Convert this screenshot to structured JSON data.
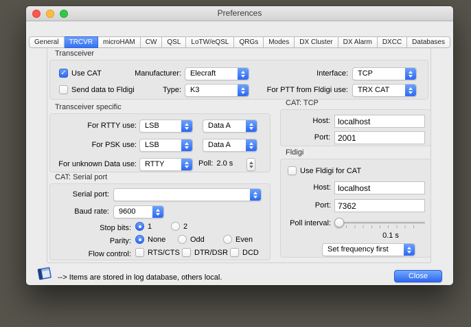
{
  "window": {
    "title": "Preferences",
    "tabs": [
      {
        "label": "General",
        "selected": false
      },
      {
        "label": "TRCVR",
        "selected": true
      },
      {
        "label": "microHAM",
        "selected": false
      },
      {
        "label": "CW",
        "selected": false
      },
      {
        "label": "QSL",
        "selected": false
      },
      {
        "label": "LoTW/eQSL",
        "selected": false
      },
      {
        "label": "QRGs",
        "selected": false
      },
      {
        "label": "Modes",
        "selected": false
      },
      {
        "label": "DX Cluster",
        "selected": false
      },
      {
        "label": "DX Alarm",
        "selected": false
      },
      {
        "label": "DXCC",
        "selected": false
      },
      {
        "label": "Databases",
        "selected": false
      }
    ]
  },
  "transceiver": {
    "group_label": "Transceiver",
    "use_cat": {
      "label": "Use CAT",
      "checked": true
    },
    "send_fldigi": {
      "label": "Send data to Fldigi",
      "checked": false
    },
    "manufacturer": {
      "label": "Manufacturer:",
      "value": "Elecraft"
    },
    "type": {
      "label": "Type:",
      "value": "K3"
    },
    "interface": {
      "label": "Interface:",
      "value": "TCP"
    },
    "ptt": {
      "label": "For PTT from Fldigi use:",
      "value": "TRX CAT"
    }
  },
  "transceiver_specific": {
    "group_label": "Transceiver specific",
    "rtty": {
      "label": "For RTTY use:",
      "mode": "LSB",
      "data": "Data A"
    },
    "psk": {
      "label": "For PSK use:",
      "mode": "LSB",
      "data": "Data A"
    },
    "unknown": {
      "label": "For unknown Data use:",
      "mode": "RTTY"
    },
    "poll": {
      "label": "Poll:",
      "value": "2.0 s"
    }
  },
  "serial": {
    "group_label": "CAT: Serial port",
    "port": {
      "label": "Serial port:",
      "value": ""
    },
    "baud": {
      "label": "Baud rate:",
      "value": "9600"
    },
    "stop_bits": {
      "label": "Stop bits:",
      "options": [
        {
          "label": "1",
          "selected": true
        },
        {
          "label": "2",
          "selected": false
        }
      ]
    },
    "parity": {
      "label": "Parity:",
      "options": [
        {
          "label": "None",
          "selected": true
        },
        {
          "label": "Odd",
          "selected": false
        },
        {
          "label": "Even",
          "selected": false
        }
      ]
    },
    "flow": {
      "label": "Flow control:",
      "options": [
        {
          "label": "RTS/CTS",
          "checked": false
        },
        {
          "label": "DTR/DSR",
          "checked": false
        },
        {
          "label": "DCD",
          "checked": false
        }
      ]
    }
  },
  "cat_tcp": {
    "group_label": "CAT: TCP",
    "host": {
      "label": "Host:",
      "value": "localhost"
    },
    "port": {
      "label": "Port:",
      "value": "2001"
    }
  },
  "fldigi": {
    "group_label": "Fldigi",
    "use_fldigi": {
      "label": "Use Fldigi for CAT",
      "checked": false
    },
    "host": {
      "label": "Host:",
      "value": "localhost"
    },
    "port": {
      "label": "Port:",
      "value": "7362"
    },
    "poll_interval": {
      "label": "Poll interval:",
      "value": "0.1 s"
    },
    "frequency_mode": {
      "value": "Set frequency first"
    }
  },
  "footer": {
    "note": "--> Items are stored in log database, others local.",
    "close_label": "Close"
  },
  "colors": {
    "accent_blue": "#3a74f2",
    "window_bg": "#ececec",
    "desktop_bg": "#56544b",
    "traffic_red": "#fc5753",
    "traffic_yellow": "#fdbc40",
    "traffic_green": "#33c748"
  },
  "icons": {
    "footer_icon": "log-book-icon",
    "popup_icon": "chevron-up-down-icon"
  }
}
